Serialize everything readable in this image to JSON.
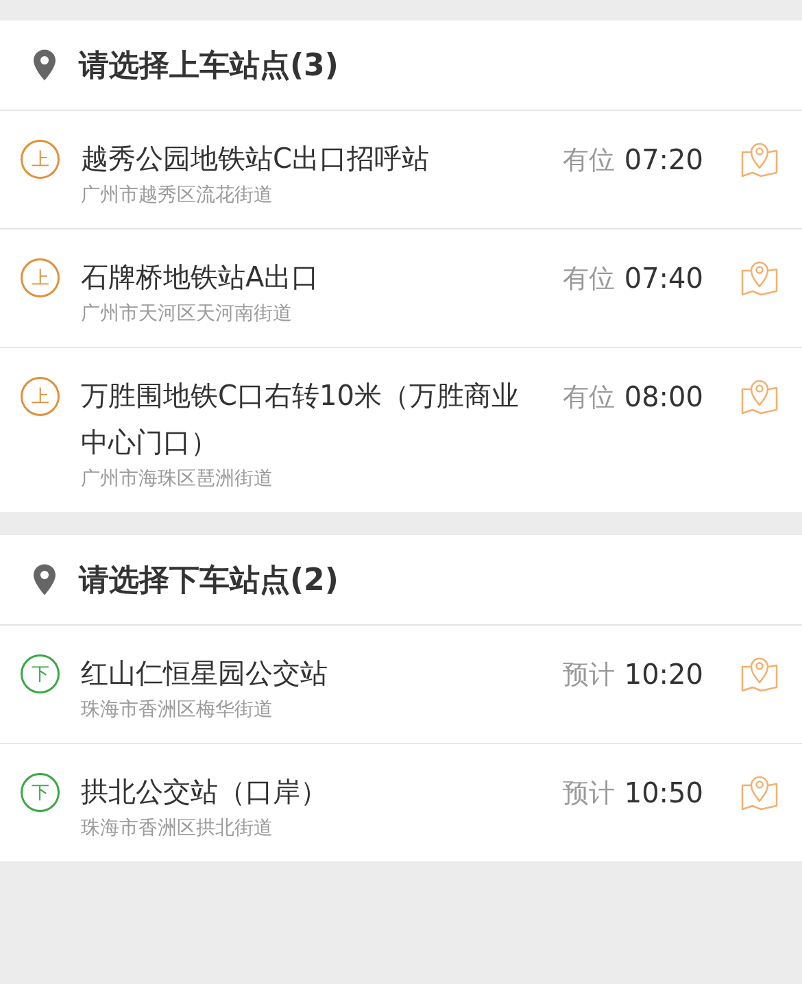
{
  "sections": [
    {
      "title": "请选择上车站点(3)",
      "stations": [
        {
          "badge": "上",
          "kind": "board",
          "name": "越秀公园地铁站C出口招呼站",
          "address": "广州市越秀区流花街道",
          "status": "有位",
          "time": "07:20"
        },
        {
          "badge": "上",
          "kind": "board",
          "name": "石牌桥地铁站A出口",
          "address": "广州市天河区天河南街道",
          "status": "有位",
          "time": "07:40"
        },
        {
          "badge": "上",
          "kind": "board",
          "name": "万胜围地铁C口右转10米（万胜商业中心门口）",
          "address": "广州市海珠区琶洲街道",
          "status": "有位",
          "time": "08:00"
        }
      ]
    },
    {
      "title": "请选择下车站点(2)",
      "stations": [
        {
          "badge": "下",
          "kind": "alight",
          "name": "红山仁恒星园公交站",
          "address": "珠海市香洲区梅华街道",
          "status": "预计",
          "time": "10:20"
        },
        {
          "badge": "下",
          "kind": "alight",
          "name": "拱北公交站（口岸）",
          "address": "珠海市香洲区拱北街道",
          "status": "预计",
          "time": "10:50"
        }
      ]
    }
  ]
}
